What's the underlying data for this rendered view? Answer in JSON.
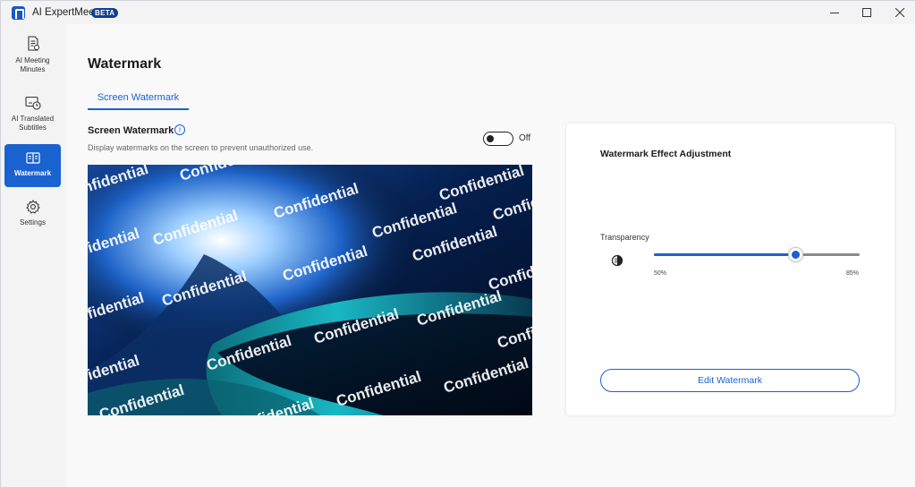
{
  "app": {
    "title": "AI ExpertMeet",
    "badge": "BETA"
  },
  "sidebar": {
    "items": [
      {
        "label": "AI Meeting Minutes",
        "icon": "document-icon",
        "active": false
      },
      {
        "label": "AI Translated Subtitles",
        "icon": "subtitles-clock-icon",
        "active": false
      },
      {
        "label": "Watermark",
        "icon": "book-icon",
        "active": true
      },
      {
        "label": "Settings",
        "icon": "gear-icon",
        "active": false
      }
    ]
  },
  "main": {
    "title": "Watermark",
    "tabs": [
      {
        "label": "Screen Watermark",
        "active": true
      }
    ],
    "section": {
      "title": "Screen Watermark",
      "description": "Display watermarks on the screen to prevent unauthorized use.",
      "toggle_label": "Off",
      "toggle_on": false
    },
    "preview": {
      "watermark_text": "Confidential"
    }
  },
  "panel": {
    "title": "Watermark Effect Adjustment",
    "transparency_label": "Transparency",
    "slider_min_label": "50%",
    "slider_max_label": "85%",
    "slider_value_fraction": 0.69,
    "edit_button": "Edit Watermark"
  },
  "colors": {
    "accent": "#1a62d0",
    "badge": "#0f3f92"
  }
}
